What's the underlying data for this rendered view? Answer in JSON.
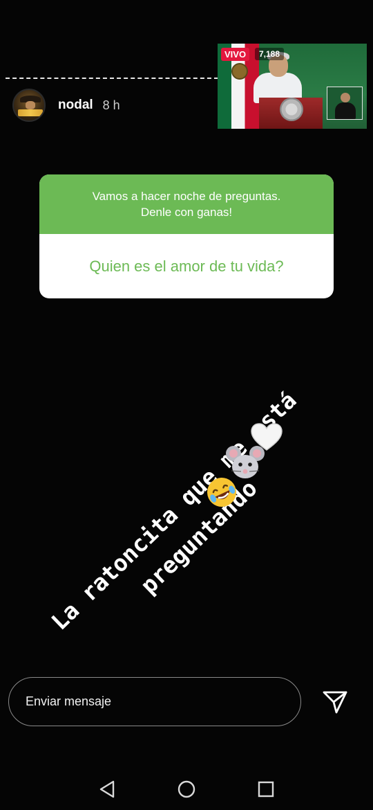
{
  "story": {
    "username": "nodal",
    "time_ago": "8 h"
  },
  "live": {
    "badge": "VIVO",
    "viewers": "7,188"
  },
  "question_sticker": {
    "prompt": "Vamos a hacer noche de preguntas.\nDenle con ganas!",
    "question": "Quien es el amor de tu vida?"
  },
  "caption": {
    "text": "La ratoncita que me está\npreguntando"
  },
  "emojis": [
    "white-heart",
    "mouse-face",
    "rolling-on-floor-laughing"
  ],
  "message_bar": {
    "placeholder": "Enviar mensaje"
  },
  "colors": {
    "sticker_green": "#6cba55",
    "live_red": "#e4173e",
    "background": "#050505"
  },
  "icons": [
    "send-icon",
    "nav-back-icon",
    "nav-home-icon",
    "nav-recent-apps-icon"
  ]
}
